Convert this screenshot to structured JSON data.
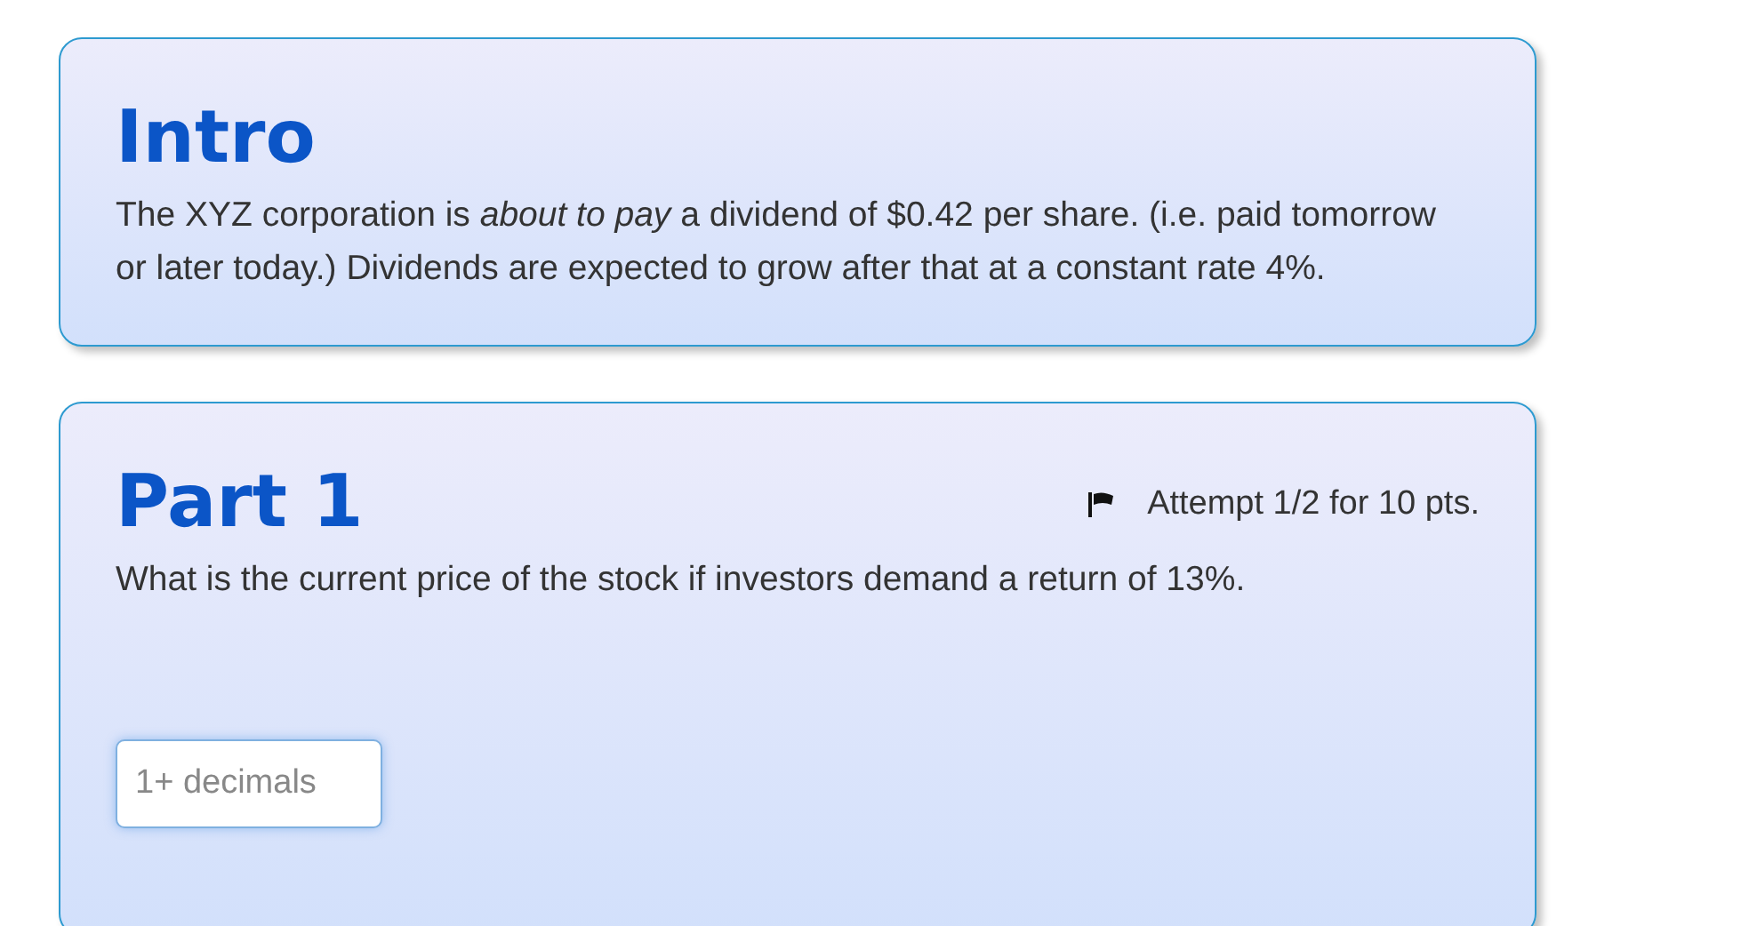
{
  "cards": [
    {
      "title": "Intro",
      "text": "The XYZ corporation is *about to pay* a dividend of $0.42 per share. (i.e. paid tomorrow or later today.)  Dividends are expected to grow after that at a constant rate 4%."
    },
    {
      "title": "Part 1",
      "attempt": "Attempt 1/2 for 10 pts.",
      "text": "What is the current price of the stock if investors demand a return of 13%.",
      "answer": {
        "placeholder": "1+ decimals"
      }
    }
  ]
}
